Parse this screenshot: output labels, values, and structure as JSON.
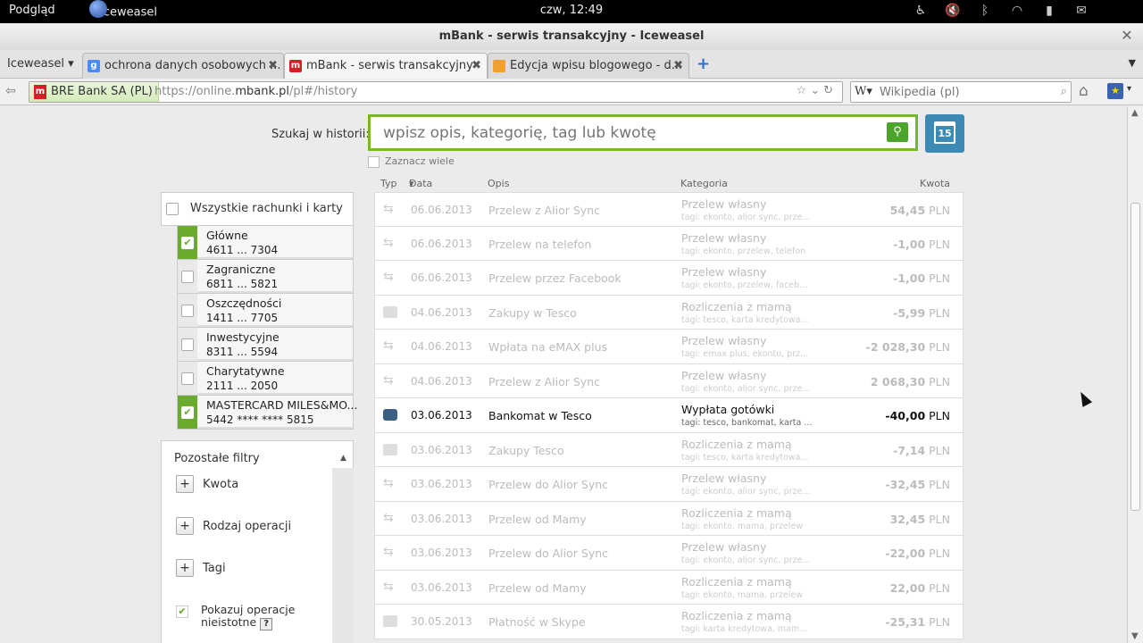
{
  "topbar": {
    "activities": "Podgląd",
    "app_name": "Iceweasel",
    "clock": "czw, 12:49"
  },
  "window": {
    "title": "mBank - serwis transakcyjny - Iceweasel"
  },
  "tabs": {
    "app_menu": "Iceweasel",
    "items": [
      {
        "label": "ochrona danych osobowych ...",
        "favicon": "google-icon"
      },
      {
        "label": "mBank - serwis transakcyjny",
        "favicon": "mbank-icon"
      },
      {
        "label": "Edycja wpisu blogowego - d...",
        "favicon": "blog-icon"
      }
    ]
  },
  "navbar": {
    "identity": "BRE Bank SA (PL)",
    "url_prefix": "https://online.",
    "url_domain": "mbank.pl",
    "url_suffix": "/pl#/history",
    "search_placeholder": "Wikipedia (pl)"
  },
  "search": {
    "label": "Szukaj w historii:",
    "placeholder": "wpisz opis, kategorię, tag lub kwotę",
    "calendar_day": "15",
    "multi_select": "Zaznacz wiele"
  },
  "accounts": {
    "all_label": "Wszystkie rachunki i karty",
    "items": [
      {
        "name": "Główne",
        "number": "4611 ... 7304",
        "checked": true
      },
      {
        "name": "Zagraniczne",
        "number": "6811 ... 5821",
        "checked": false
      },
      {
        "name": "Oszczędności",
        "number": "1411 ... 7705",
        "checked": false
      },
      {
        "name": "Inwestycyjne",
        "number": "8311 ... 5594",
        "checked": false
      },
      {
        "name": "Charytatywne",
        "number": "2111 ... 2050",
        "checked": false
      },
      {
        "name": "MASTERCARD MILES&MO...",
        "number": "5442 **** **** 5815",
        "checked": true
      }
    ]
  },
  "filters": {
    "header": "Pozostałe filtry",
    "items": [
      "Kwota",
      "Rodzaj operacji",
      "Tagi"
    ],
    "show_unimportant": "Pokazuj operacje nieistotne",
    "help": "?"
  },
  "history": {
    "columns": {
      "type": "Typ",
      "date": "Data",
      "desc": "Opis",
      "category": "Kategoria",
      "amount": "Kwota"
    },
    "currency": "PLN",
    "rows": [
      {
        "type": "transfer",
        "date": "06.06.2013",
        "desc": "Przelew z Alior Sync",
        "category": "Przelew własny",
        "tags": "tagi: ekonto, alior sync, prze...",
        "amount": "54,45"
      },
      {
        "type": "transfer",
        "date": "06.06.2013",
        "desc": "Przelew na telefon",
        "category": "Przelew własny",
        "tags": "tagi: ekonto, przelew, telefon",
        "amount": "-1,00"
      },
      {
        "type": "transfer",
        "date": "06.06.2013",
        "desc": "Przelew przez Facebook",
        "category": "Przelew własny",
        "tags": "tagi: ekonto, przelew, faceb...",
        "amount": "-1,00"
      },
      {
        "type": "card",
        "date": "04.06.2013",
        "desc": "Zakupy w Tesco",
        "category": "Rozliczenia z mamą",
        "tags": "tagi: tesco, karta kredytowa...",
        "amount": "-5,99"
      },
      {
        "type": "transfer",
        "date": "04.06.2013",
        "desc": "Wpłata na eMAX plus",
        "category": "Przelew własny",
        "tags": "tagi: emax plus, ekonto, prz...",
        "amount": "-2 028,30"
      },
      {
        "type": "transfer",
        "date": "04.06.2013",
        "desc": "Przelew z Alior Sync",
        "category": "Przelew własny",
        "tags": "tagi: ekonto, alior sync, prze...",
        "amount": "2 068,30"
      },
      {
        "type": "wallet",
        "date": "03.06.2013",
        "desc": "Bankomat w Tesco",
        "category": "Wypłata gotówki",
        "tags": "tagi: tesco, bankomat, karta ...",
        "amount": "-40,00",
        "active": true
      },
      {
        "type": "card",
        "date": "03.06.2013",
        "desc": "Zakupy Tesco",
        "category": "Rozliczenia z mamą",
        "tags": "tagi: tesco, karta kredytowa...",
        "amount": "-7,14"
      },
      {
        "type": "transfer",
        "date": "03.06.2013",
        "desc": "Przelew do Alior Sync",
        "category": "Przelew własny",
        "tags": "tagi: ekonto, alior sync, prze...",
        "amount": "-32,45"
      },
      {
        "type": "transfer",
        "date": "03.06.2013",
        "desc": "Przelew od Mamy",
        "category": "Rozliczenia z mamą",
        "tags": "tagi: ekonto, mama, przelew",
        "amount": "32,45"
      },
      {
        "type": "transfer",
        "date": "03.06.2013",
        "desc": "Przelew do Alior Sync",
        "category": "Przelew własny",
        "tags": "tagi: ekonto, alior sync, prze...",
        "amount": "-22,00"
      },
      {
        "type": "transfer",
        "date": "03.06.2013",
        "desc": "Przelew od Mamy",
        "category": "Rozliczenia z mamą",
        "tags": "tagi: ekonto, mama, przelew",
        "amount": "22,00"
      },
      {
        "type": "card",
        "date": "30.05.2013",
        "desc": "Płatność w Skype",
        "category": "Rozliczenia z mamą",
        "tags": "tagi: karta kredytowa, mam...",
        "amount": "-25,31"
      }
    ]
  },
  "colors": {
    "accent_green": "#76b82a",
    "calendar_blue": "#3d8ab5",
    "mbank_red": "#d32027"
  }
}
